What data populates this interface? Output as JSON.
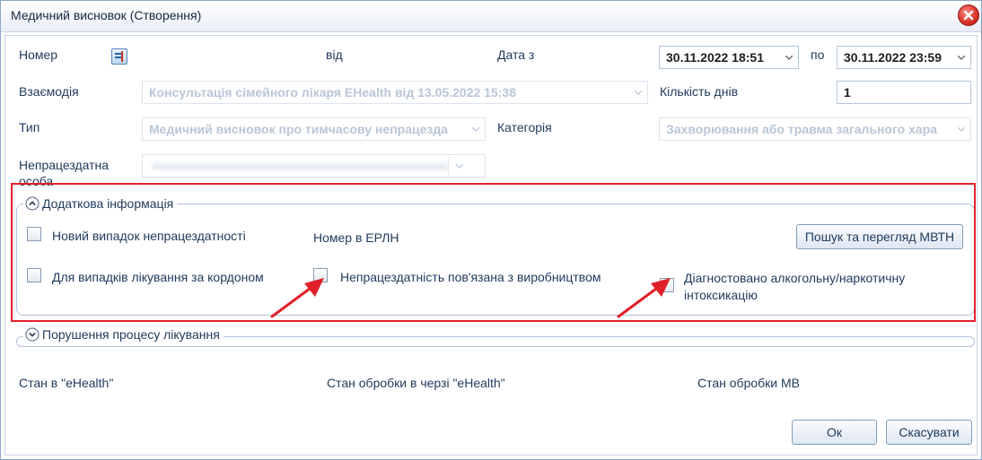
{
  "window": {
    "title": "Медичний висновок (Створення)"
  },
  "form": {
    "number_label": "Номер",
    "from_label": "від",
    "date_from_label": "Дата з",
    "date_from_value": "30.11.2022 18:51",
    "to_label": "по",
    "date_to_value": "30.11.2022 23:59",
    "interaction_label": "Взаємодія",
    "interaction_value": "Консультація сімейного лікаря EHealth від 13.05.2022 15:38",
    "days_label": "Кількість днів",
    "days_value": "1",
    "type_label": "Тип",
    "type_value": "Медичний висновок про тимчасову непрацезда",
    "category_label": "Категорія",
    "category_value": "Захворювання або травма загального хара",
    "disabled_person_label_line1": "Непрацездатна",
    "disabled_person_label_line2": "особа"
  },
  "additional": {
    "title": "Додаткова інформація",
    "new_case_label": "Новий випадок непрацездатності",
    "erln_label": "Номер в ЕРЛН",
    "search_button": "Пошук та перегляд МВТН",
    "abroad_label": "Для випадків лікування за кордоном",
    "work_related_label": "Непрацездатність пов'язана з виробництвом",
    "intoxication_label_line1": "Діагностовано алкогольну/наркотичну",
    "intoxication_label_line2": "інтоксикацію"
  },
  "violations": {
    "title": "Порушення процесу лікування"
  },
  "status": {
    "ehealth_label": "Стан в \"eHealth\"",
    "queue_label": "Стан обробки в черзі \"eHealth\"",
    "mv_label": "Стан обробки МВ"
  },
  "buttons": {
    "ok": "Ок",
    "cancel": "Скасувати"
  },
  "colors": {
    "highlight": "#e0202a",
    "accent_text": "#1e395b"
  },
  "icons": [
    "close-icon",
    "number-generator-icon",
    "chevron-up-icon",
    "chevron-down-icon",
    "arrow-icon"
  ]
}
